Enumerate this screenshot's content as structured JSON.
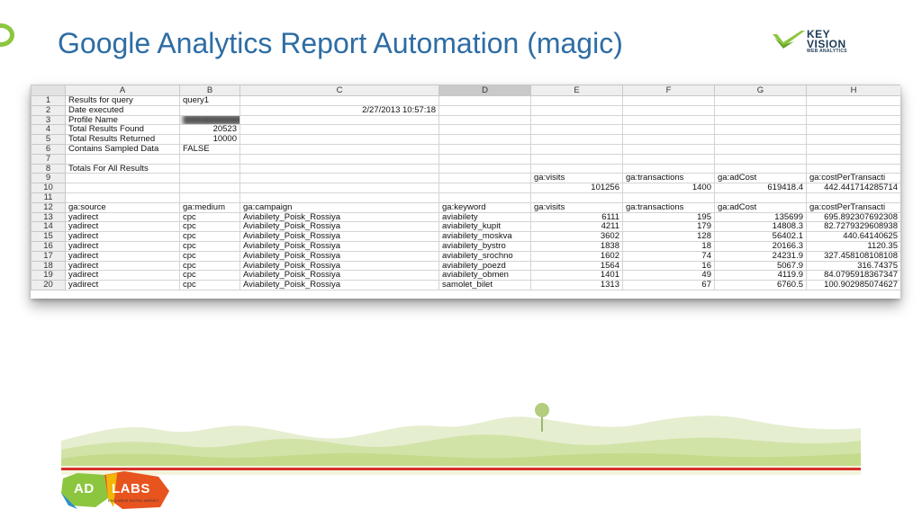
{
  "slide": {
    "title": "Google Analytics Report Automation (magic)"
  },
  "logo_keyvision": {
    "line1": "KEY",
    "line2": "VISION",
    "line3": "WEB ANALYTICS",
    "colors": {
      "check": "#8cc63f",
      "text": "#1d3a55"
    }
  },
  "logo_adlabs": {
    "left": "AD",
    "right": "LABS",
    "tagline": "EXCLUSIVE DIGITAL AGENCY"
  },
  "spreadsheet": {
    "columns": [
      "A",
      "B",
      "C",
      "D",
      "E",
      "F",
      "G",
      "H"
    ],
    "selected_column": "D",
    "rows": [
      {
        "n": "1",
        "cells": [
          "Results for query",
          "query1",
          "",
          "",
          "",
          "",
          "",
          ""
        ]
      },
      {
        "n": "2",
        "cells": [
          "Date executed",
          "",
          "2/27/2013 10:57:18",
          "",
          "",
          "",
          "",
          ""
        ]
      },
      {
        "n": "3",
        "cells": [
          "Profile Name",
          "",
          "",
          "",
          "",
          "",
          "",
          ""
        ]
      },
      {
        "n": "4",
        "cells": [
          "Total Results Found",
          "20523",
          "",
          "",
          "",
          "",
          "",
          ""
        ]
      },
      {
        "n": "5",
        "cells": [
          "Total Results Returned",
          "10000",
          "",
          "",
          "",
          "",
          "",
          ""
        ]
      },
      {
        "n": "6",
        "cells": [
          "Contains Sampled Data",
          "FALSE",
          "",
          "",
          "",
          "",
          "",
          ""
        ]
      },
      {
        "n": "7",
        "cells": [
          "",
          "",
          "",
          "",
          "",
          "",
          "",
          ""
        ]
      },
      {
        "n": "8",
        "cells": [
          "Totals For All Results",
          "",
          "",
          "",
          "",
          "",
          "",
          ""
        ]
      },
      {
        "n": "9",
        "cells": [
          "",
          "",
          "",
          "",
          "ga:visits",
          "ga:transactions",
          "ga:adCost",
          "ga:costPerTransacti"
        ]
      },
      {
        "n": "10",
        "cells": [
          "",
          "",
          "",
          "",
          "101256",
          "1400",
          "619418.4",
          "442.441714285714"
        ]
      },
      {
        "n": "11",
        "cells": [
          "",
          "",
          "",
          "",
          "",
          "",
          "",
          ""
        ]
      },
      {
        "n": "12",
        "cells": [
          "ga:source",
          "ga:medium",
          "ga:campaign",
          "ga:keyword",
          "ga:visits",
          "ga:transactions",
          "ga:adCost",
          "ga:costPerTransacti"
        ]
      },
      {
        "n": "13",
        "cells": [
          "yadirect",
          "cpc",
          "Aviabilety_Poisk_Rossiya",
          "aviabilety",
          "6111",
          "195",
          "135699",
          "695.892307692308"
        ]
      },
      {
        "n": "14",
        "cells": [
          "yadirect",
          "cpc",
          "Aviabilety_Poisk_Rossiya",
          "aviabilety_kupit",
          "4211",
          "179",
          "14808.3",
          "82.7279329608938"
        ]
      },
      {
        "n": "15",
        "cells": [
          "yadirect",
          "cpc",
          "Aviabilety_Poisk_Rossiya",
          "aviabilety_moskva",
          "3602",
          "128",
          "56402.1",
          "440.64140625"
        ]
      },
      {
        "n": "16",
        "cells": [
          "yadirect",
          "cpc",
          "Aviabilety_Poisk_Rossiya",
          "aviabilety_bystro",
          "1838",
          "18",
          "20166.3",
          "1120.35"
        ]
      },
      {
        "n": "17",
        "cells": [
          "yadirect",
          "cpc",
          "Aviabilety_Poisk_Rossiya",
          "aviabilety_srochno",
          "1602",
          "74",
          "24231.9",
          "327.458108108108"
        ]
      },
      {
        "n": "18",
        "cells": [
          "yadirect",
          "cpc",
          "Aviabilety_Poisk_Rossiya",
          "aviabilety_poezd",
          "1564",
          "16",
          "5067.9",
          "316.74375"
        ]
      },
      {
        "n": "19",
        "cells": [
          "yadirect",
          "cpc",
          "Aviabilety_Poisk_Rossiya",
          "aviabilety_obmen",
          "1401",
          "49",
          "4119.9",
          "84.0795918367347"
        ]
      },
      {
        "n": "20",
        "cells": [
          "yadirect",
          "cpc",
          "Aviabilety_Poisk_Rossiya",
          "samolet_bilet",
          "1313",
          "67",
          "6760.5",
          "100.902985074627"
        ]
      }
    ]
  }
}
